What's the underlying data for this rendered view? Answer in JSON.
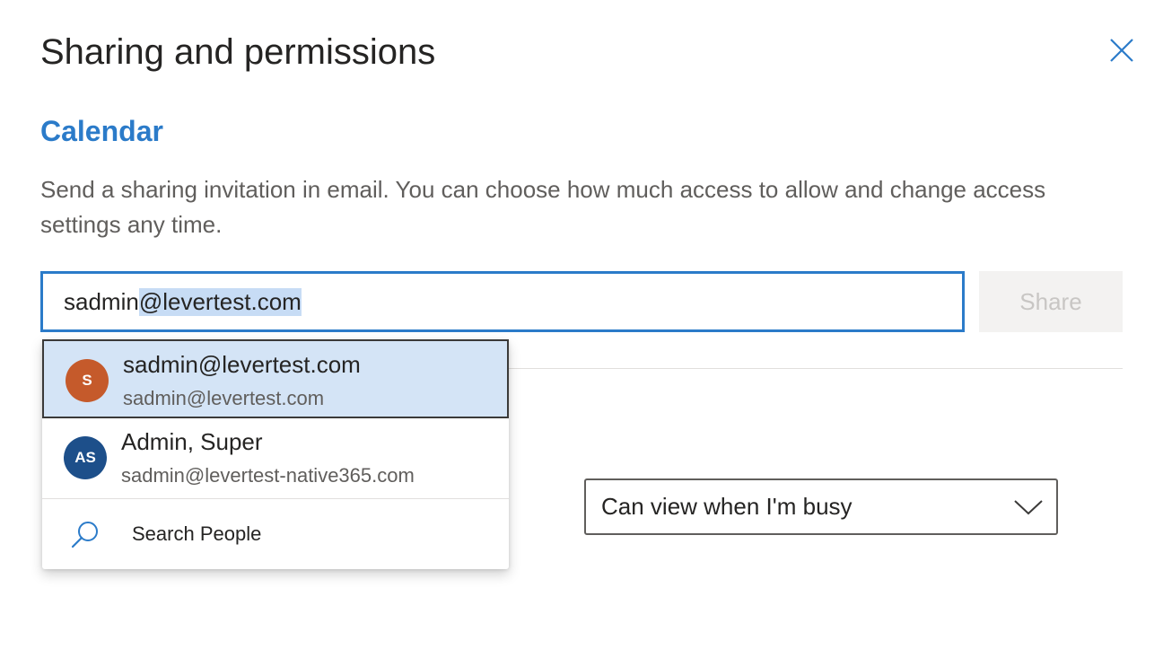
{
  "dialog": {
    "title": "Sharing and permissions",
    "close_icon": "close-icon"
  },
  "section": {
    "heading": "Calendar",
    "description": "Send a sharing invitation in email. You can choose how much access to allow and change access settings any time."
  },
  "invite": {
    "input_typed": "sadmin",
    "input_autocomplete": "@levertest.com",
    "share_label": "Share"
  },
  "suggestions": [
    {
      "initials": "S",
      "name": "sadmin@levertest.com",
      "email": "sadmin@levertest.com",
      "avatar_color": "#c55a2b",
      "selected": true
    },
    {
      "initials": "AS",
      "name": "Admin, Super",
      "email": "sadmin@levertest-native365.com",
      "avatar_color": "#1d4f8a",
      "selected": false
    }
  ],
  "search_people": {
    "icon": "search-icon",
    "label": "Search People"
  },
  "permission": {
    "selected": "Can view when I'm busy",
    "icon": "chevron-down-icon"
  },
  "colors": {
    "accent": "#2b7bc9",
    "selected_bg": "#d4e4f6"
  }
}
